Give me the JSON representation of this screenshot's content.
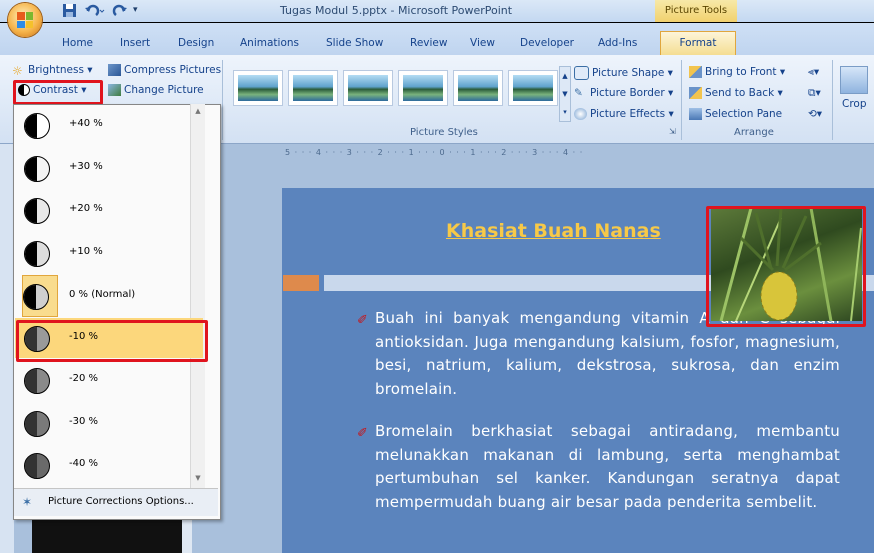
{
  "window": {
    "title": "Tugas Modul 5.pptx - Microsoft PowerPoint",
    "contextual_tab_group": "Picture Tools"
  },
  "quick_access": [
    "save-icon",
    "undo-icon",
    "redo-icon"
  ],
  "tabs": [
    "Home",
    "Insert",
    "Design",
    "Animations",
    "Slide Show",
    "Review",
    "View",
    "Developer",
    "Add-Ins",
    "Format"
  ],
  "active_tab": "Format",
  "ribbon": {
    "adjust": {
      "brightness": "Brightness",
      "compress": "Compress Pictures",
      "contrast": "Contrast",
      "change": "Change Picture"
    },
    "picture_styles": {
      "label": "Picture Styles",
      "shape": "Picture Shape",
      "border": "Picture Border",
      "effects": "Picture Effects"
    },
    "arrange": {
      "label": "Arrange",
      "bring_front": "Bring to Front",
      "send_back": "Send to Back",
      "selection_pane": "Selection Pane"
    },
    "crop": "Crop"
  },
  "contrast_menu": {
    "items": [
      {
        "label": "+40 %",
        "shade": "#ffffff"
      },
      {
        "label": "+30 %",
        "shade": "#f4f4f4"
      },
      {
        "label": "+20 %",
        "shade": "#e8e8e8"
      },
      {
        "label": "+10 %",
        "shade": "#dddddd"
      },
      {
        "label": "0 % (Normal)",
        "shade": "#cfcfcf"
      },
      {
        "label": "-10 %",
        "shade": "#9a9a9a"
      },
      {
        "label": "-20 %",
        "shade": "#8a8a8a"
      },
      {
        "label": "-30 %",
        "shade": "#7a7a7a"
      },
      {
        "label": "-40 %",
        "shade": "#6a6a6a"
      }
    ],
    "selected": "0 % (Normal)",
    "hovered": "-10 %",
    "footer": "Picture Corrections Options..."
  },
  "ruler_text": "5 · · · 4 · · · 3 · · · 2 · · · 1 · · · 0 · · · 1 · · · 2 · · · 3 · · · 4 · ·",
  "slide": {
    "title": "Khasiat Buah Nanas",
    "bullets": [
      "Buah ini banyak mengandung vitamin A dan C sebagai antioksidan. Juga mengandung kalsium, fosfor, magnesium, besi, natrium, kalium, dekstrosa, sukrosa, dan enzim bromelain.",
      "Bromelain berkhasiat sebagai antiradang, membantu melunakkan makanan di lambung, serta menghambat pertumbuhan sel kanker. Kandungan seratnya dapat mempermudah buang air besar pada penderita sembelit."
    ]
  },
  "colors": {
    "slide_bg": "#5b84bd",
    "title_gold": "#f7c948",
    "highlight_red": "#e0141e",
    "menu_hover": "#fcd77c"
  }
}
